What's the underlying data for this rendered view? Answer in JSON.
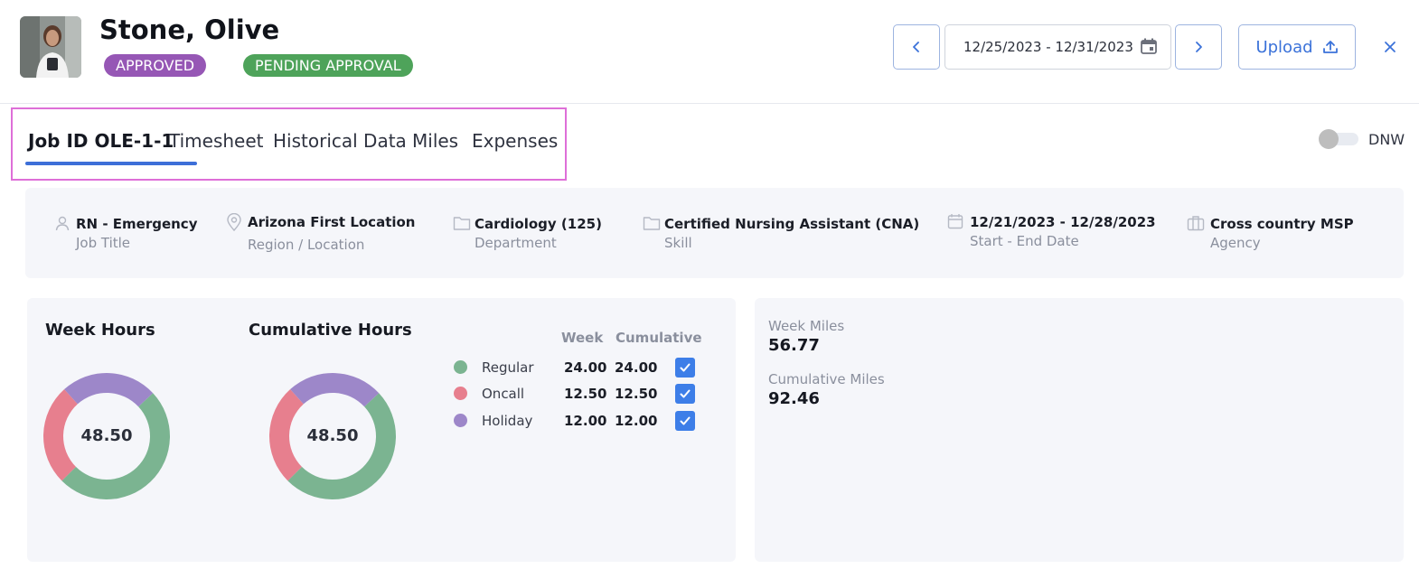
{
  "header": {
    "employee_name": "Stone, Olive",
    "badges": {
      "approved": "APPROVED",
      "pending": "PENDING APPROVAL"
    },
    "date_range": "12/25/2023 - 12/31/2023",
    "upload_label": "Upload"
  },
  "tabs": [
    {
      "label": "Job ID OLE-1-1",
      "active": true
    },
    {
      "label": "Timesheet",
      "active": false
    },
    {
      "label": "Historical Data",
      "active": false
    },
    {
      "label": "Miles",
      "active": false
    },
    {
      "label": "Expenses",
      "active": false
    }
  ],
  "dnw": {
    "label": "DNW",
    "on": false
  },
  "job_info": [
    {
      "value": "RN - Emergency",
      "label": "Job Title",
      "icon": "person-icon"
    },
    {
      "value": "Arizona First Location",
      "label": "Region / Location",
      "icon": "location-pin-icon"
    },
    {
      "value": "Cardiology (125)",
      "label": "Department",
      "icon": "folder-icon"
    },
    {
      "value": "Certified Nursing Assistant (CNA)",
      "label": "Skill",
      "icon": "folder-icon"
    },
    {
      "value": "12/21/2023 - 12/28/2023",
      "label": "Start - End Date",
      "icon": "calendar-icon"
    },
    {
      "value": "Cross country MSP",
      "label": "Agency",
      "icon": "briefcase-icon"
    }
  ],
  "hours": {
    "week_title": "Week Hours",
    "cumulative_title": "Cumulative Hours",
    "week_total": "48.50",
    "cumulative_total": "48.50",
    "col_week": "Week",
    "col_cumulative": "Cumulative",
    "rows": [
      {
        "name": "Regular",
        "week": "24.00",
        "cumulative": "24.00",
        "checked": true,
        "color": "#7bb491"
      },
      {
        "name": "Oncall",
        "week": "12.50",
        "cumulative": "12.50",
        "checked": true,
        "color": "#e77f8e"
      },
      {
        "name": "Holiday",
        "week": "12.00",
        "cumulative": "12.00",
        "checked": true,
        "color": "#9d87c9"
      }
    ]
  },
  "chart_data": [
    {
      "type": "pie",
      "title": "Week Hours",
      "categories": [
        "Regular",
        "Oncall",
        "Holiday"
      ],
      "values": [
        24.0,
        12.5,
        12.0
      ],
      "colors": [
        "#7bb491",
        "#e77f8e",
        "#9d87c9"
      ],
      "center_label": "48.50"
    },
    {
      "type": "pie",
      "title": "Cumulative Hours",
      "categories": [
        "Regular",
        "Oncall",
        "Holiday"
      ],
      "values": [
        24.0,
        12.5,
        12.0
      ],
      "colors": [
        "#7bb491",
        "#e77f8e",
        "#9d87c9"
      ],
      "center_label": "48.50"
    }
  ],
  "miles": {
    "week_label": "Week Miles",
    "week_value": "56.77",
    "cumulative_label": "Cumulative Miles",
    "cumulative_value": "92.46"
  },
  "colors": {
    "accent": "#3d6fd8",
    "approved": "#9657b5",
    "pending": "#4ea35a",
    "highlight": "#de6fd8"
  }
}
